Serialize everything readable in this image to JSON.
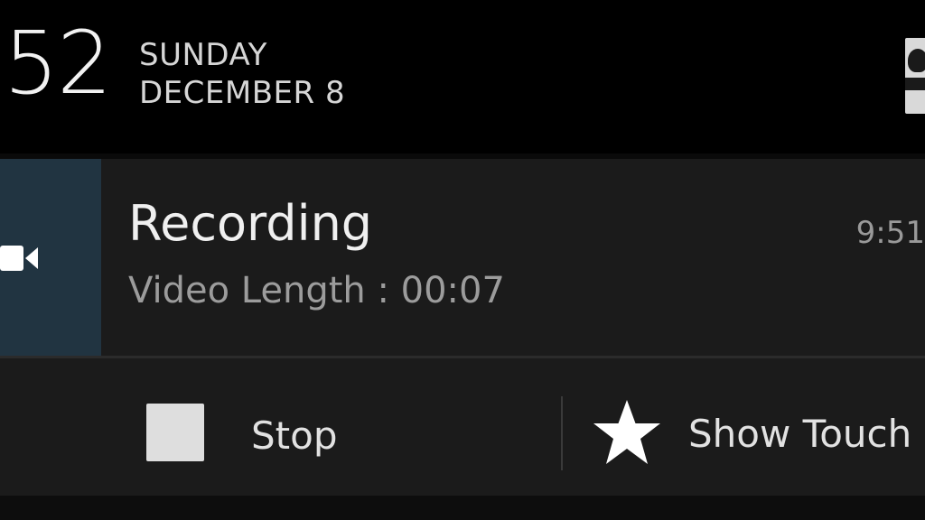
{
  "header": {
    "clock": "52",
    "day": "SUNDAY",
    "date": "DECEMBER 8",
    "profile_icon": "user-profile-icon"
  },
  "notification": {
    "icon": "video-camera-icon",
    "title": "Recording",
    "time": "9:51",
    "text": "Video Length : 00:07",
    "accent_color": "#213441"
  },
  "actions": [
    {
      "label": "Stop",
      "icon": "stop-square-icon"
    },
    {
      "label": "Show Touch",
      "icon": "star-icon"
    }
  ]
}
